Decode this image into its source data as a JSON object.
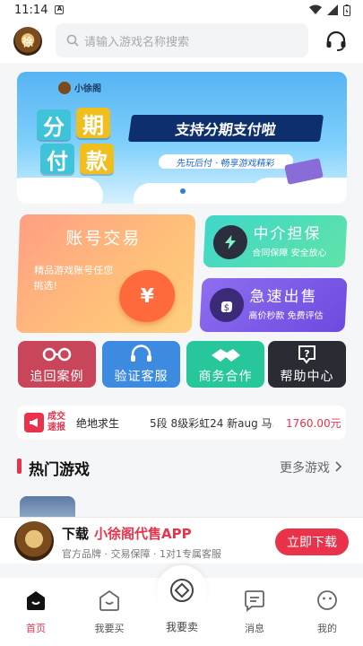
{
  "status_bar": {
    "time": "11:14",
    "notif_glyph": "A"
  },
  "header": {
    "logo_text": "徐",
    "search_placeholder": "请输入游戏名称搜索"
  },
  "banner": {
    "brand": "小徐阁",
    "chars": [
      "分",
      "期",
      "付",
      "款"
    ],
    "headline": "支持分期支付啦",
    "subline": "先玩后付 · 畅享游戏精彩"
  },
  "services": {
    "trade": {
      "title": "账号交易",
      "desc": "精品游戏账号任您挑选!",
      "icon_glyph": "¥"
    },
    "escrow": {
      "title": "中介担保",
      "desc": "合同保障 安全放心"
    },
    "fast": {
      "title": "急速出售",
      "desc": "高价秒款 免费评估"
    }
  },
  "quick_links": [
    {
      "label": "追回案例",
      "icon": "handcuffs-icon"
    },
    {
      "label": "验证客服",
      "icon": "headset-icon"
    },
    {
      "label": "商务合作",
      "icon": "handshake-icon"
    },
    {
      "label": "帮助中心",
      "icon": "help-icon"
    }
  ],
  "ticker": {
    "badge": "成交速报",
    "game": "绝地求生",
    "detail": "5段 8级彩虹24 新aug 马...",
    "price": "1760.00元"
  },
  "hot_games": {
    "title": "热门游戏",
    "more": "更多游戏"
  },
  "promo": {
    "title_prefix": "下载",
    "title_app": "小徐阁代售APP",
    "desc": "官方品牌 · 交易保障 · 1对1专属客服",
    "button": "立即下载"
  },
  "tabs": [
    {
      "label": "首页",
      "icon": "home-icon",
      "active": true
    },
    {
      "label": "我要买",
      "icon": "shopping-bag-icon"
    },
    {
      "label": "我要卖",
      "icon": "sell-icon"
    },
    {
      "label": "消息",
      "icon": "message-icon"
    },
    {
      "label": "我的",
      "icon": "profile-icon"
    }
  ],
  "colors": {
    "accent": "#e8334a"
  }
}
